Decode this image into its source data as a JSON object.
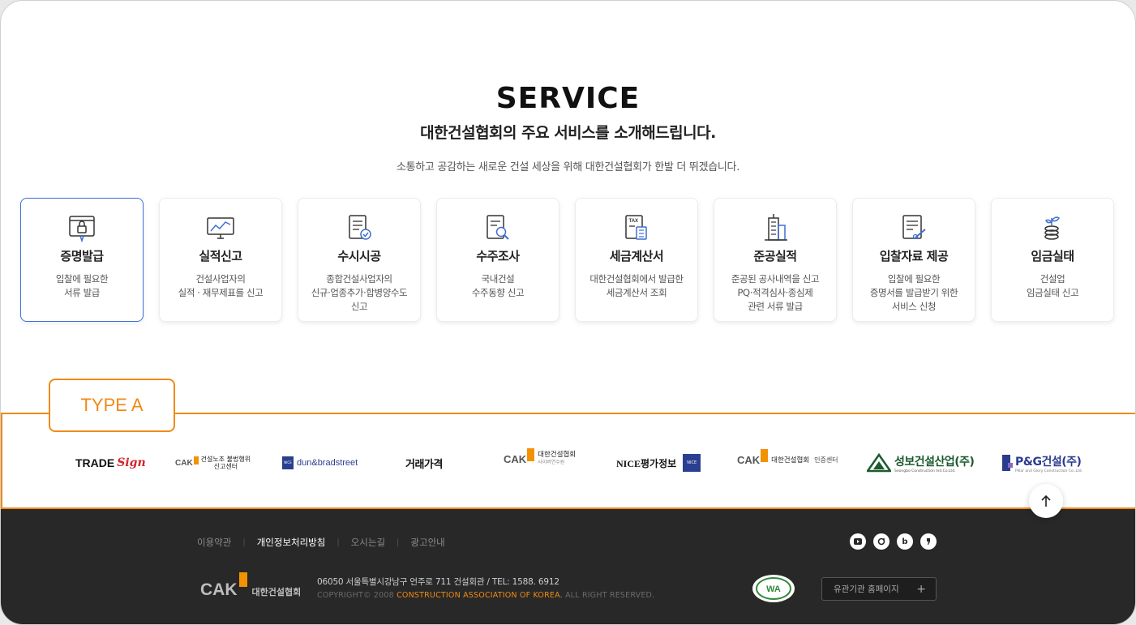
{
  "hero": {
    "title": "SERVICE",
    "subtitle": "대한건설협회의 주요 서비스를 소개해드립니다.",
    "description": "소통하고 공감하는 새로운 건설 세상을 위해 대한건설협회가 한발 더 뛰겠습니다."
  },
  "services": [
    {
      "title": "증명발급",
      "desc": "입찰에 필요한\n서류 발급",
      "icon": "certificate-lock-icon",
      "active": true
    },
    {
      "title": "실적신고",
      "desc": "건설사업자의\n실적 · 재무제표를 신고",
      "icon": "chart-monitor-icon"
    },
    {
      "title": "수시시공",
      "desc": "종합건설사업자의\n신규·업종추가·합병양수도\n신고",
      "icon": "document-check-icon"
    },
    {
      "title": "수주조사",
      "desc": "국내건설\n수주동향 신고",
      "icon": "document-search-icon"
    },
    {
      "title": "세금계산서",
      "desc": "대한건설협회에서 발급한\n세금계산서 조회",
      "icon": "tax-calculator-icon"
    },
    {
      "title": "준공실적",
      "desc": "준공된 공사내역을 신고\nPQ·적격심사·종심제\n관련 서류 발급",
      "icon": "building-icon"
    },
    {
      "title": "입찰자료 제공",
      "desc": "입찰에 필요한\n증명서를 발급받기 위한\n서비스 신청",
      "icon": "document-pen-icon"
    },
    {
      "title": "임금실태",
      "desc": "건설업\n임금실태 신고",
      "icon": "coin-sprout-icon"
    }
  ],
  "type_label": "TYPE A",
  "partners": {
    "trade_sign": {
      "a": "TRADE",
      "b": "Sign"
    },
    "cak_illegal": {
      "cak": "CAK",
      "line1": "건설노조 불법행위",
      "line2": "신고센터"
    },
    "dun": {
      "box": "NICE",
      "text": "dun&bradstreet"
    },
    "price": {
      "text": "거래가격"
    },
    "cak_cyber": {
      "cak": "CAK",
      "line1": "대한건설협회",
      "line2": "사이버연수원"
    },
    "nice_rating": {
      "text": "NICE평가정보",
      "box": "NICE"
    },
    "cak_cert": {
      "cak": "CAK",
      "line1": "대한건설협회",
      "line2": "인증센터"
    },
    "seongbo": {
      "text": "성보건설산업(주)",
      "sub": "Seongbo Construction Ind.Co.Ltd."
    },
    "pg": {
      "text": "P&G건설(주)",
      "sub": "Pillar and Glory Construction Co.,Ltd."
    }
  },
  "footer": {
    "links": [
      {
        "label": "이용약관",
        "strong": false
      },
      {
        "label": "개인정보처리방침",
        "strong": true
      },
      {
        "label": "오시는길",
        "strong": false
      },
      {
        "label": "광고안내",
        "strong": false
      }
    ],
    "logo_cak": "CAK",
    "logo_kr": "대한건설협회",
    "address": "06050 서울특별시강남구 언주로 711 건설회관 / TEL: 1588. 6912",
    "copyright_prefix": "COPYRIGHT© 2008 ",
    "copyright_org": "CONSTRUCTION ASSOCIATION OF KOREA.",
    "copyright_suffix": " ALL RIGHT RESERVED.",
    "wa_mark": "WA",
    "related_sites": "유관기관 홈페이지",
    "related_plus": "+"
  },
  "colors": {
    "accent": "#f08a16",
    "active_border": "#3f6fd1",
    "footer_bg": "#282828",
    "cak_orange": "#f39200"
  }
}
